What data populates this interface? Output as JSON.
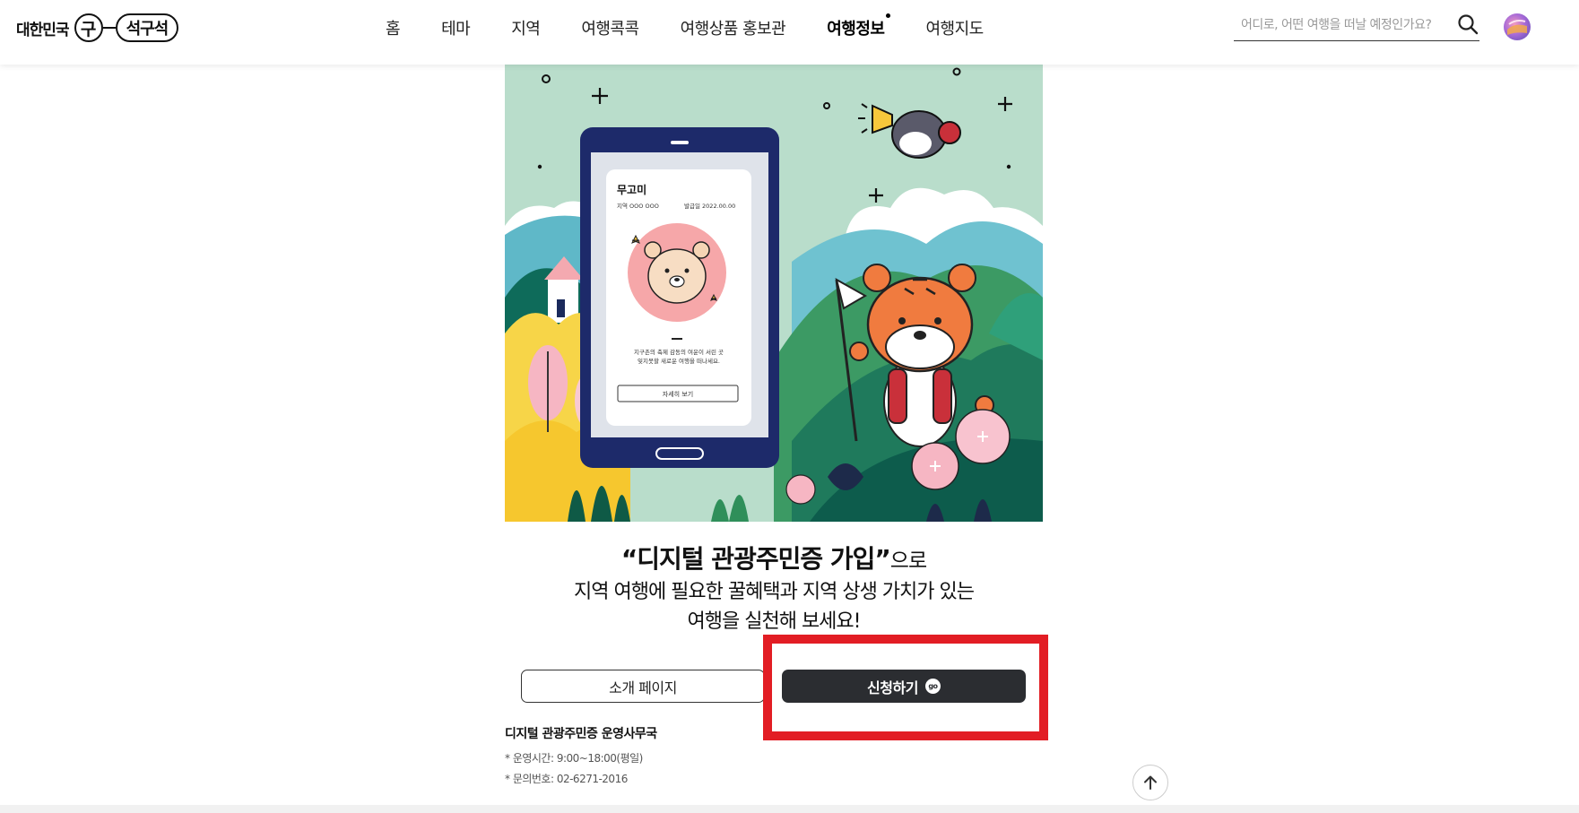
{
  "header": {
    "logo_text": "대한민국",
    "logo_mark_char": "구",
    "logo_pill_text": "석구석",
    "nav": [
      {
        "label": "홈",
        "active": false
      },
      {
        "label": "테마",
        "active": false
      },
      {
        "label": "지역",
        "active": false
      },
      {
        "label": "여행콕콕",
        "active": false
      },
      {
        "label": "여행상품 홍보관",
        "active": false
      },
      {
        "label": "여행정보",
        "active": true
      },
      {
        "label": "여행지도",
        "active": false
      }
    ],
    "search_placeholder": "어디로, 어떤 여행을 떠날 예정인가요?"
  },
  "hero": {
    "card_name": "무고미",
    "card_region_label": "지역",
    "card_region_value": "OOO OOO",
    "card_issue_label": "발급일",
    "card_issue_value": "2022.00.00",
    "card_desc_1": "지구촌의 축제 감동의 여운이 서린 곳",
    "card_desc_2": "잊지못할 새로운 여행을 떠나세요.",
    "card_button": "자세히 보기"
  },
  "copy": {
    "quote_open": "“",
    "highlight": "디지털 관광주민증 가입",
    "quote_close": "”",
    "suffix": "으로",
    "line2": "지역 여행에 필요한 꿀혜택과 지역 상생 가치가 있는",
    "line3": "여행을 실천해 보세요!"
  },
  "buttons": {
    "intro_label": "소개 페이지",
    "apply_label": "신청하기",
    "apply_badge": "go"
  },
  "office": {
    "title": "디지털 관광주민증 운영사무국",
    "hours": "* 운영시간: 9:00~18:00(평일)",
    "phone": "* 문의번호: 02-6271-2016"
  },
  "colors": {
    "accent_dark": "#2b2d31",
    "highlight_red": "#e21d24",
    "hero_bg": "#b9ddcb"
  }
}
